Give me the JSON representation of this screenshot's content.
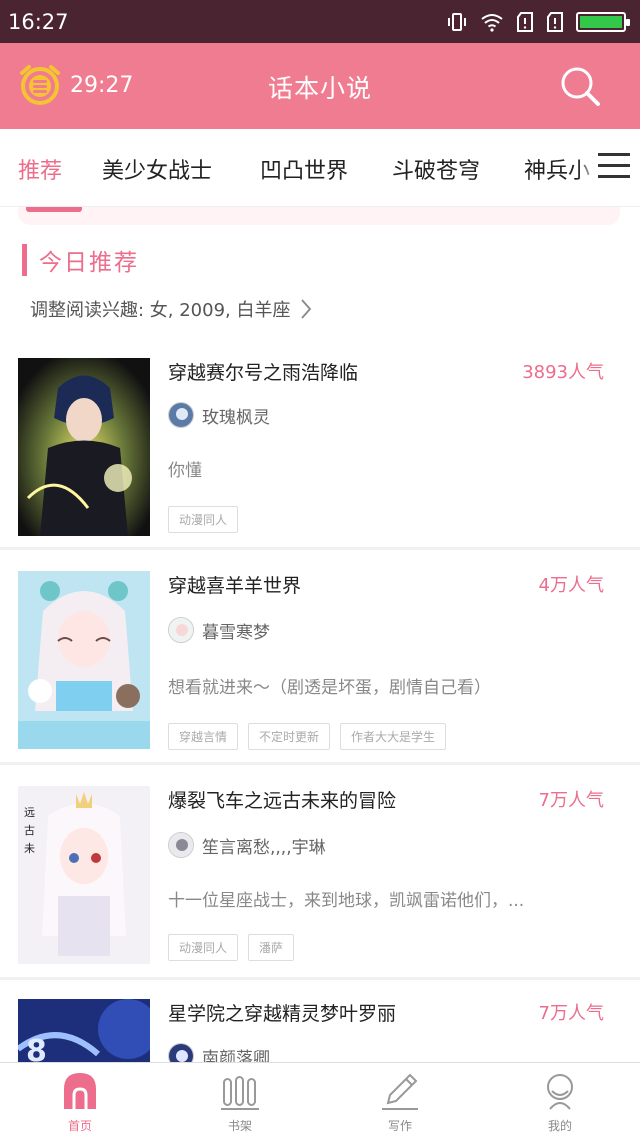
{
  "status_bar": {
    "time": "16:27"
  },
  "header": {
    "timer": "29:27",
    "title": "话本小说"
  },
  "tabs": [
    "推荐",
    "美少女战士",
    "凹凸世界",
    "斗破苍穹",
    "神兵小"
  ],
  "section": {
    "title": "今日推荐",
    "interest": "调整阅读兴趣: 女, 2009, 白羊座"
  },
  "books": [
    {
      "title": "穿越赛尔号之雨浩降临",
      "popularity": "3893人气",
      "author": "玫瑰枫灵",
      "desc": "你懂",
      "tags": [
        "动漫同人"
      ]
    },
    {
      "title": "穿越喜羊羊世界",
      "popularity": "4万人气",
      "author": "暮雪寒梦",
      "desc": "想看就进来～（剧透是坏蛋，剧情自己看）",
      "tags": [
        "穿越言情",
        "不定时更新",
        "作者大大是学生"
      ]
    },
    {
      "title": "爆裂飞车之远古未来的冒险",
      "popularity": "7万人气",
      "author": "笙言离愁,,,,宇琳",
      "desc": "十一位星座战士，来到地球，凯飒雷诺他们，...",
      "tags": [
        "动漫同人",
        "潘萨"
      ]
    },
    {
      "title": "星学院之穿越精灵梦叶罗丽",
      "popularity": "7万人气",
      "author": "南颜落卿",
      "desc": "",
      "tags": []
    }
  ],
  "bottom_nav": [
    {
      "label": "首页",
      "icon": "home-icon",
      "active": true
    },
    {
      "label": "书架",
      "icon": "bookshelf-icon",
      "active": false
    },
    {
      "label": "写作",
      "icon": "pencil-icon",
      "active": false
    },
    {
      "label": "我的",
      "icon": "profile-icon",
      "active": false
    }
  ],
  "colors": {
    "accent": "#ec6d8c",
    "header_bg": "#f07c92",
    "status_bg": "#4a2430"
  }
}
